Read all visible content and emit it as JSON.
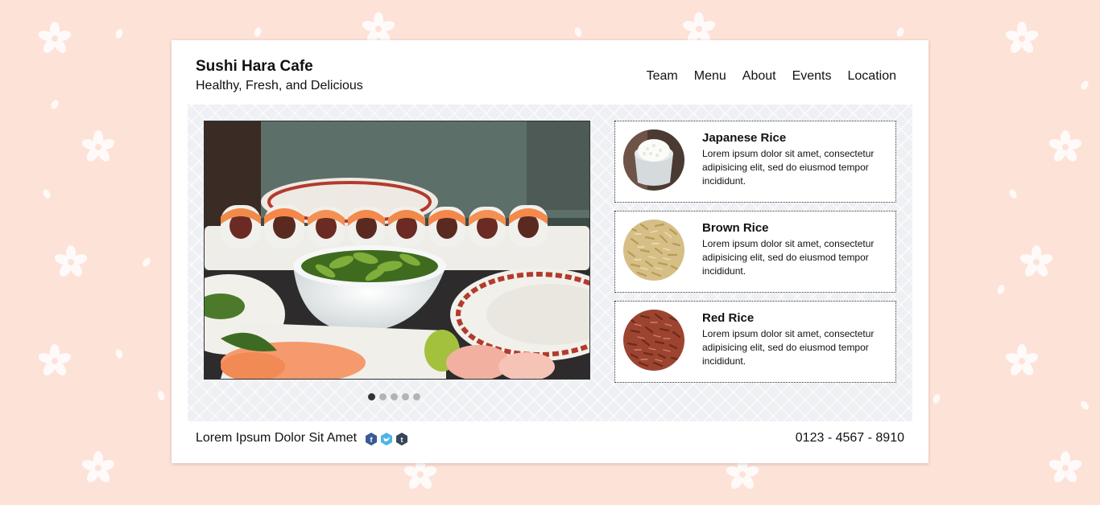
{
  "header": {
    "title": "Sushi Hara Cafe",
    "subtitle": "Healthy, Fresh, and Delicious"
  },
  "nav": {
    "items": [
      "Team",
      "Menu",
      "About",
      "Events",
      "Location"
    ]
  },
  "slider": {
    "dot_count": 5,
    "active_index": 0
  },
  "rice": [
    {
      "name": "Japanese Rice",
      "description": "Lorem ipsum dolor sit amet, consectetur adipisicing elit, sed do eiusmod tempor incididunt."
    },
    {
      "name": "Brown Rice",
      "description": "Lorem ipsum dolor sit amet, consectetur adipisicing elit, sed do eiusmod tempor incididunt."
    },
    {
      "name": "Red Rice",
      "description": "Lorem ipsum dolor sit amet, consectetur adipisicing elit, sed do eiusmod tempor incididunt."
    }
  ],
  "footer": {
    "text": "Lorem Ipsum Dolor Sit Amet",
    "phone": "0123 - 4567 - 8910",
    "social_icons": [
      "facebook-icon",
      "twitter-icon",
      "tumblr-icon"
    ]
  },
  "colors": {
    "background": "#fde2d8",
    "card": "#ffffff",
    "content_bg": "#eef0f3",
    "facebook": "#3b5998",
    "twitter": "#4fb3e8",
    "tumblr": "#35465c"
  }
}
